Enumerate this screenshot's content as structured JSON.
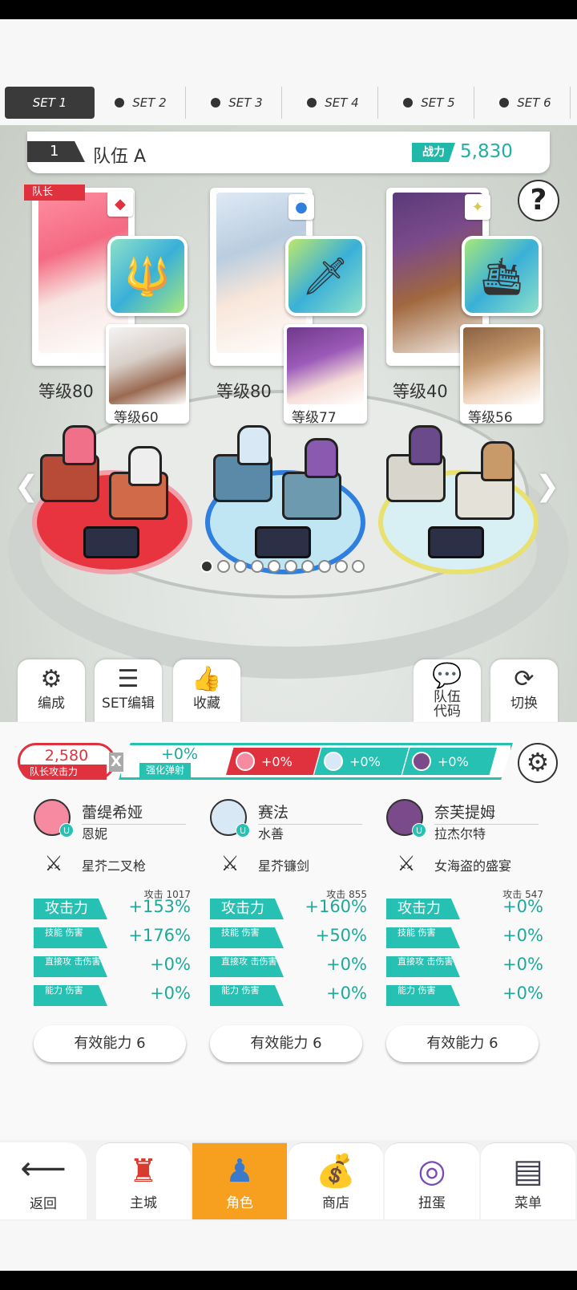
{
  "set_tabs": [
    {
      "label": "SET 1",
      "active": true
    },
    {
      "label": "SET 2",
      "active": false
    },
    {
      "label": "SET 3",
      "active": false
    },
    {
      "label": "SET 4",
      "active": false
    },
    {
      "label": "SET 5",
      "active": false
    },
    {
      "label": "SET 6",
      "active": false
    }
  ],
  "team": {
    "number": "1",
    "name": "队伍 A",
    "power_label": "战力",
    "power_value": "5,830"
  },
  "help_label": "?",
  "leader_tag": "队长",
  "heroes": [
    {
      "level": "等级80",
      "element": "red-diamonds",
      "weapon_icon": "golden-trident-icon",
      "sub_level": "等级60",
      "color": "#e0323e"
    },
    {
      "level": "等级80",
      "element": "blue-circle",
      "weapon_icon": "blue-sickle-sword-icon",
      "sub_level": "等级77",
      "color": "#2f7fe0"
    },
    {
      "level": "等级40",
      "element": "yellow-star",
      "weapon_icon": "blue-ship-orb-icon",
      "sub_level": "等级56",
      "color": "#e8d85a"
    }
  ],
  "page_dots": {
    "total": 10,
    "active_index": 0
  },
  "actions": {
    "formation": "编成",
    "set_edit": "SET编辑",
    "favorite": "收藏",
    "team_code_line1": "队伍",
    "team_code_line2": "代码",
    "switch": "切换"
  },
  "bonus": {
    "leader_attack_value": "2,580",
    "leader_attack_label": "队长攻击力",
    "x": "X",
    "enhance_value": "+0%",
    "enhance_label": "强化弹射",
    "chips": [
      "+0%",
      "+0%",
      "+0%"
    ]
  },
  "characters": [
    {
      "name": "蕾缇希娅",
      "sub": "恩妮",
      "weapon": "星芥二叉枪",
      "uflag": "U",
      "atk_raw": "攻击  1017",
      "stats": [
        {
          "label": "攻击力",
          "value": "+153%"
        },
        {
          "label": "技能 伤害",
          "value": "+176%"
        },
        {
          "label": "直接攻 击伤害",
          "value": "+0%"
        },
        {
          "label": "能力 伤害",
          "value": "+0%"
        }
      ],
      "effective": "有效能力 6"
    },
    {
      "name": "赛法",
      "sub": "水善",
      "weapon": "星芥镰剑",
      "uflag": "U",
      "atk_raw": "攻击  855",
      "stats": [
        {
          "label": "攻击力",
          "value": "+160%"
        },
        {
          "label": "技能 伤害",
          "value": "+50%"
        },
        {
          "label": "直接攻 击伤害",
          "value": "+0%"
        },
        {
          "label": "能力 伤害",
          "value": "+0%"
        }
      ],
      "effective": "有效能力 6"
    },
    {
      "name": "奈芙提姆",
      "sub": "拉杰尔特",
      "weapon": "女海盗的盛宴",
      "uflag": "U",
      "atk_raw": "攻击  547",
      "stats": [
        {
          "label": "攻击力",
          "value": "+0%"
        },
        {
          "label": "技能 伤害",
          "value": "+0%"
        },
        {
          "label": "直接攻 击伤害",
          "value": "+0%"
        },
        {
          "label": "能力 伤害",
          "value": "+0%"
        }
      ],
      "effective": "有效能力 6"
    }
  ],
  "nav": {
    "back": "返回",
    "main_city": "主城",
    "character": "角色",
    "shop": "商店",
    "gacha": "扭蛋",
    "menu": "菜单"
  },
  "colors": {
    "accent_teal": "#26c1b2",
    "leader_red": "#e0323e",
    "active_nav": "#f7a01f"
  }
}
